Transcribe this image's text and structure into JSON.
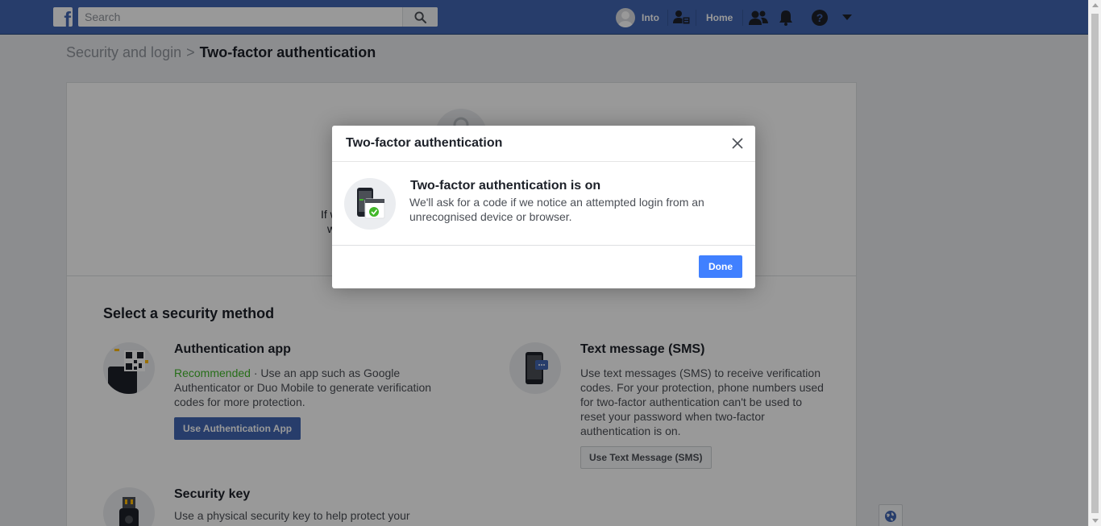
{
  "topbar": {
    "search_placeholder": "Search",
    "user_name": "Into",
    "home_label": "Home",
    "brand_color": "#4267b2"
  },
  "breadcrumb": {
    "parent": "Security and login",
    "separator": ">",
    "current": "Two-factor authentication"
  },
  "hero": {
    "text_fragment_1": "If w",
    "text_fragment_2": "w"
  },
  "security": {
    "section_title": "Select a security method",
    "methods": [
      {
        "title": "Authentication app",
        "recommended": "Recommended",
        "desc": " · Use an app such as Google Authenticator or Duo Mobile to generate verification codes for more protection.",
        "button": "Use Authentication App"
      },
      {
        "title": "Text message (SMS)",
        "desc": "Use text messages (SMS) to receive verification codes. For your protection, phone numbers used for two-factor authentication can't be used to reset your password when two-factor authentication is on.",
        "button": "Use Text Message (SMS)"
      },
      {
        "title": "Security key",
        "desc": "Use a physical security key to help protect your"
      }
    ]
  },
  "modal": {
    "title": "Two-factor authentication",
    "heading": "Two-factor authentication is on",
    "text": "We'll ask for a code if we notice an attempted login from an unrecognised device or browser.",
    "done_label": "Done",
    "accent_color": "#4080ff",
    "success_color": "#42b72a"
  },
  "icons": {
    "logo": "facebook-logo",
    "search": "search-icon",
    "friends": "friend-requests-icon",
    "find_friends": "find-friends-icon",
    "notifications": "bell-icon",
    "help": "help-icon",
    "menu": "chevron-down-icon",
    "close": "close-icon",
    "globe": "globe-icon"
  }
}
